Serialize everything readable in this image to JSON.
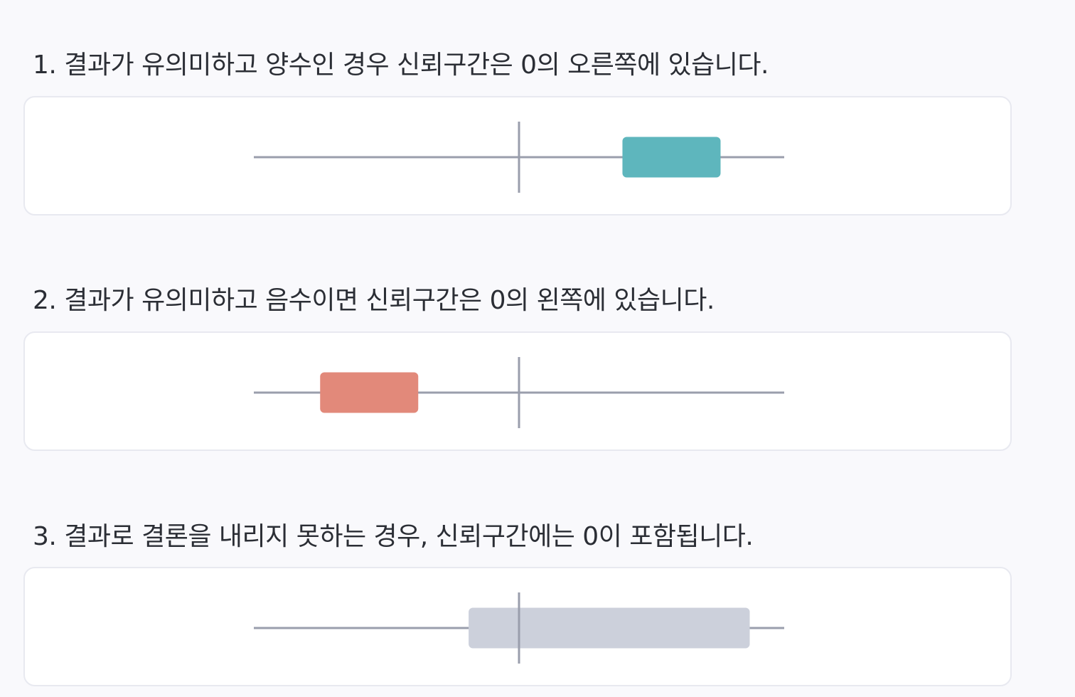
{
  "statements": [
    {
      "text": "1. 결과가 유의미하고 양수인 경우 신뢰구간은 0의 오른쪽에 있습니다.",
      "color": "#5eb6bd",
      "interval": [
        0.39,
        0.76
      ]
    },
    {
      "text": "2. 결과가 유의미하고 음수이면 신뢰구간은 0의 왼쪽에 있습니다.",
      "color": "#e2897a",
      "interval": [
        -0.75,
        -0.38
      ]
    },
    {
      "text": "3. 결과로 결론을 내리지 못하는 경우, 신뢰구간에는 0이 포함됩니다.",
      "color": "#ccd0db",
      "interval": [
        -0.19,
        0.87
      ]
    }
  ],
  "axis": {
    "range": [
      -1,
      1
    ],
    "zero": 0,
    "line_color": "#9a9eac"
  }
}
